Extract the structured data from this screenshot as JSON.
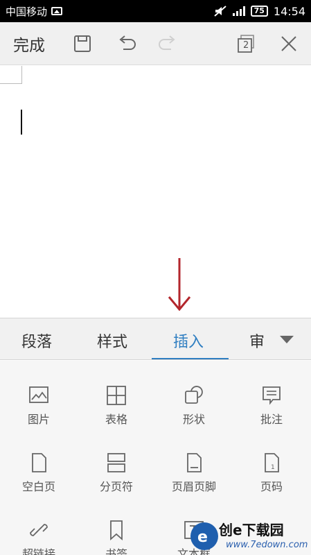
{
  "status_bar": {
    "carrier": "中国移动",
    "battery": "75",
    "time": "14:54"
  },
  "toolbar": {
    "done_label": "完成",
    "window_count": "2"
  },
  "tabs": [
    {
      "label": "段落"
    },
    {
      "label": "样式"
    },
    {
      "label": "插入",
      "active": true
    },
    {
      "label": "审"
    }
  ],
  "insert_items": [
    {
      "label": "图片",
      "icon": "image-icon"
    },
    {
      "label": "表格",
      "icon": "table-icon"
    },
    {
      "label": "形状",
      "icon": "shape-icon"
    },
    {
      "label": "批注",
      "icon": "comment-icon"
    },
    {
      "label": "空白页",
      "icon": "blank-page-icon"
    },
    {
      "label": "分页符",
      "icon": "page-break-icon"
    },
    {
      "label": "页眉页脚",
      "icon": "header-footer-icon"
    },
    {
      "label": "页码",
      "icon": "page-number-icon"
    },
    {
      "label": "超链接",
      "icon": "hyperlink-icon"
    },
    {
      "label": "书签",
      "icon": "bookmark-icon"
    },
    {
      "label": "文本框",
      "icon": "textbox-icon"
    }
  ],
  "watermark": {
    "text": "创e下载园",
    "url": "www.7edown.com"
  },
  "colors": {
    "accent": "#2f7ec1",
    "arrow": "#b3262c"
  }
}
